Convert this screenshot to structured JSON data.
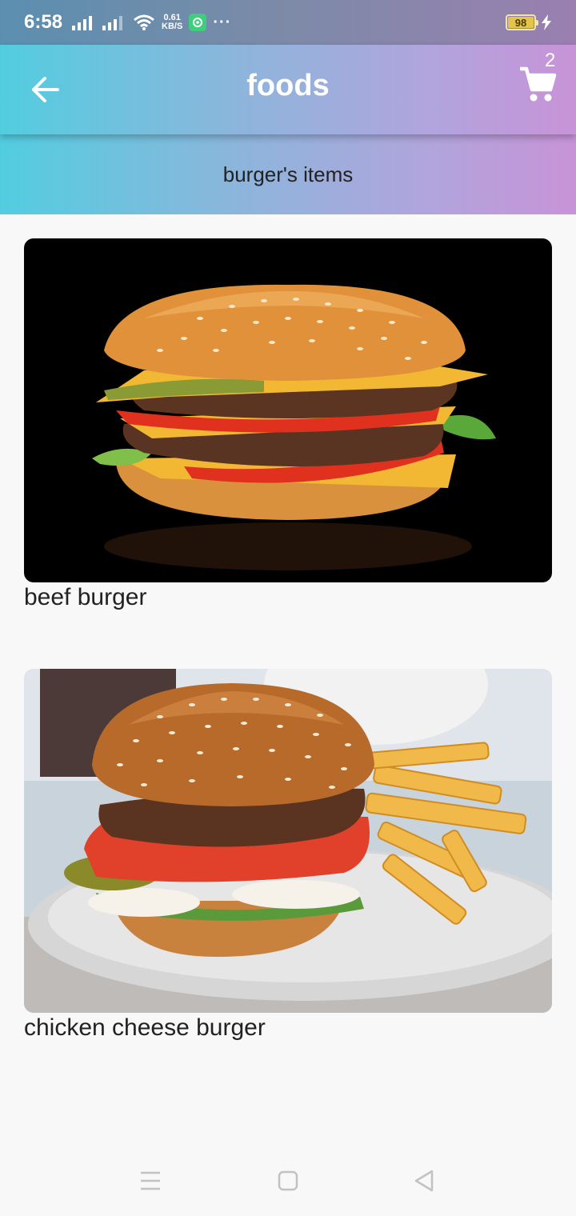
{
  "status_bar": {
    "time": "6:58",
    "net_speed_value": "0.61",
    "net_speed_unit": "KB/S",
    "overflow": "···",
    "battery": "98"
  },
  "app_bar": {
    "title": "foods",
    "cart_count": "2",
    "back_icon": "arrow-left-icon",
    "cart_icon": "shopping-cart-icon"
  },
  "sub_header": {
    "title": "burger's items"
  },
  "items": [
    {
      "name": "beef burger"
    },
    {
      "name": "chicken cheese burger"
    }
  ],
  "nav": {
    "menu_icon": "menu-icon",
    "home_icon": "home-square-icon",
    "back_icon": "back-triangle-icon"
  }
}
